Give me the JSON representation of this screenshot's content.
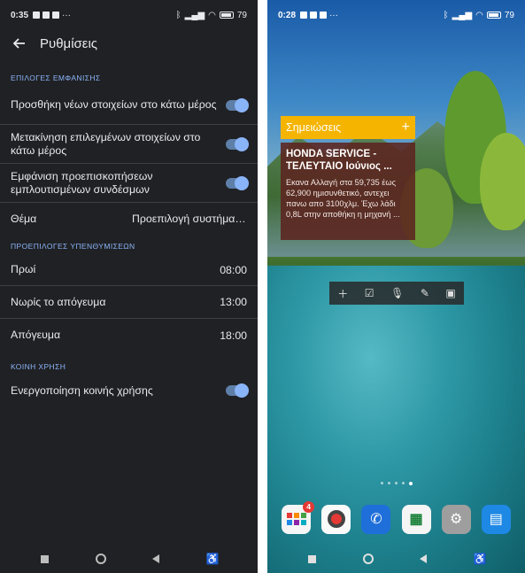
{
  "left": {
    "status": {
      "time": "0:35",
      "battery": "79"
    },
    "appbar": {
      "title": "Ρυθμίσεις"
    },
    "sections": [
      {
        "header": "ΕΠΙΛΟΓΕΣ ΕΜΦΑΝΙΣΗΣ",
        "rows": [
          {
            "label": "Προσθήκη νέων στοιχείων στο κάτω μέρος",
            "toggle": true
          },
          {
            "label": "Μετακίνηση επιλεγμένων στοιχείων στο κάτω μέρος",
            "toggle": true
          },
          {
            "label": "Εμφάνιση προεπισκοπήσεων εμπλουτισμένων συνδέσμων",
            "toggle": true
          },
          {
            "label": "Θέμα",
            "value": "Προεπιλογή συστήματ..."
          }
        ]
      },
      {
        "header": "ΠΡΟΕΠΙΛΟΓΕΣ ΥΠΕΝΘΥΜΙΣΕΩΝ",
        "rows": [
          {
            "label": "Πρωί",
            "value": "08:00"
          },
          {
            "label": "Νωρίς το απόγευμα",
            "value": "13:00"
          },
          {
            "label": "Απόγευμα",
            "value": "18:00"
          }
        ]
      },
      {
        "header": "ΚΟΙΝΗ ΧΡΗΣΗ",
        "rows": [
          {
            "label": "Ενεργοποίηση κοινής χρήσης",
            "toggle": true
          }
        ]
      }
    ]
  },
  "right": {
    "status": {
      "time": "0:28",
      "battery": "79"
    },
    "widget": {
      "header": "Σημειώσεις",
      "note_title": "HONDA SERVICE - ΤΕΛΕΥΤΑΙΟ Ιούνιος ...",
      "note_body": "Εκανα Αλλαγή στα 59,735 έως 62,900 ημισυνθετικό, αντεχει πανω απο 3100χλμ. Έχω λάδι 0,8L στην αποθήκη η μηχανή ..."
    },
    "dock": {
      "badge_count": "4"
    }
  },
  "colors": {
    "accent": "#8ab4f8",
    "toggle_track": "#5d7fa8",
    "keep_yellow": "#f4b400",
    "note_bg": "#5c2420"
  }
}
